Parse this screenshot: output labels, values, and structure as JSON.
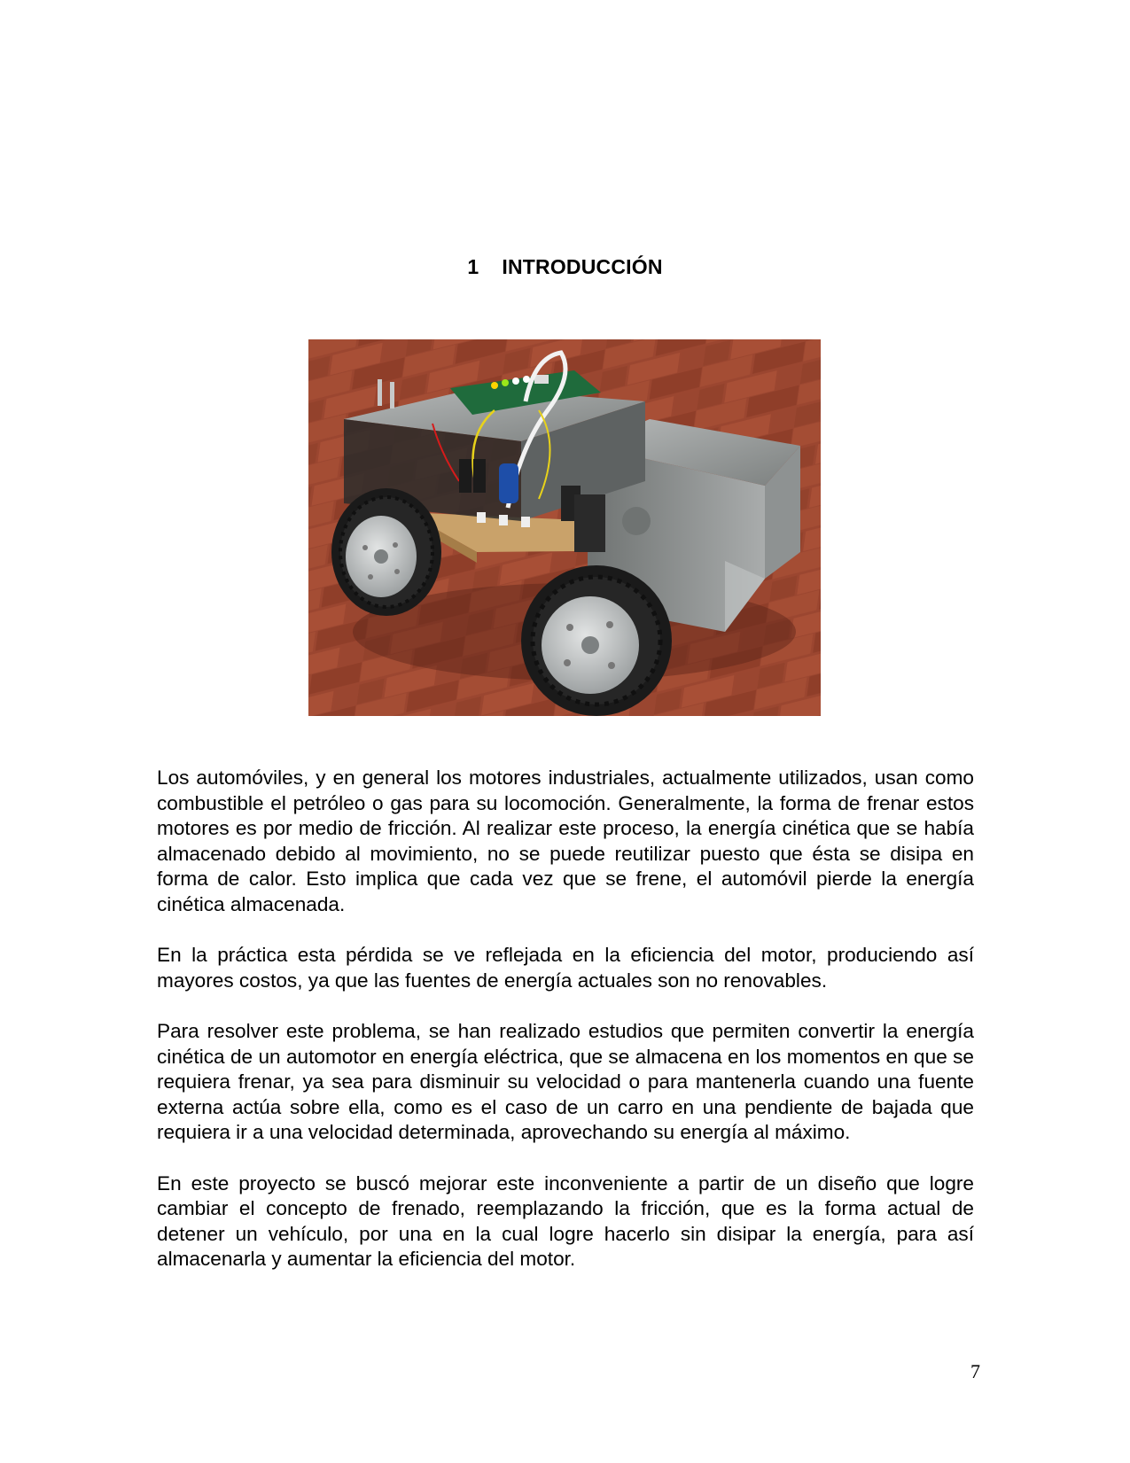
{
  "section": {
    "number": "1",
    "title": "INTRODUCCIÓN"
  },
  "figure": {
    "subject": "vehicle-prototype-photo",
    "colors": {
      "floor": "#9b4630",
      "metal": "#8a8d8c",
      "board": "#1f6b3c",
      "tire": "#1a1a1a",
      "hub": "#b9bcbd"
    }
  },
  "paragraphs": [
    "Los automóviles, y en general los motores industriales, actualmente utilizados, usan como combustible el petróleo o gas para su locomoción. Generalmente, la forma de frenar estos motores es por medio de fricción. Al realizar este proceso, la energía cinética que se había almacenado debido al movimiento, no se puede reutilizar puesto que ésta se disipa en forma de calor. Esto implica que cada vez que se frene, el automóvil pierde la energía cinética almacenada.",
    "En la práctica esta pérdida se ve reflejada en la eficiencia del motor, produciendo así mayores costos, ya que las fuentes de energía actuales son no renovables.",
    "Para resolver este problema, se han realizado estudios que permiten convertir la energía cinética de un automotor en energía eléctrica, que se almacena en los momentos en que se requiera frenar, ya sea para disminuir su velocidad o para mantenerla cuando una fuente externa actúa sobre ella, como es el caso de un carro en una pendiente de bajada que requiera ir a una velocidad determinada, aprovechando su energía al máximo.",
    "En este proyecto se buscó mejorar este inconveniente a partir de un diseño que logre cambiar el concepto de frenado, reemplazando la fricción, que es la forma actual de detener un vehículo, por una en la cual logre hacerlo sin disipar la energía, para así almacenarla y aumentar la eficiencia del motor."
  ],
  "page_number": "7"
}
